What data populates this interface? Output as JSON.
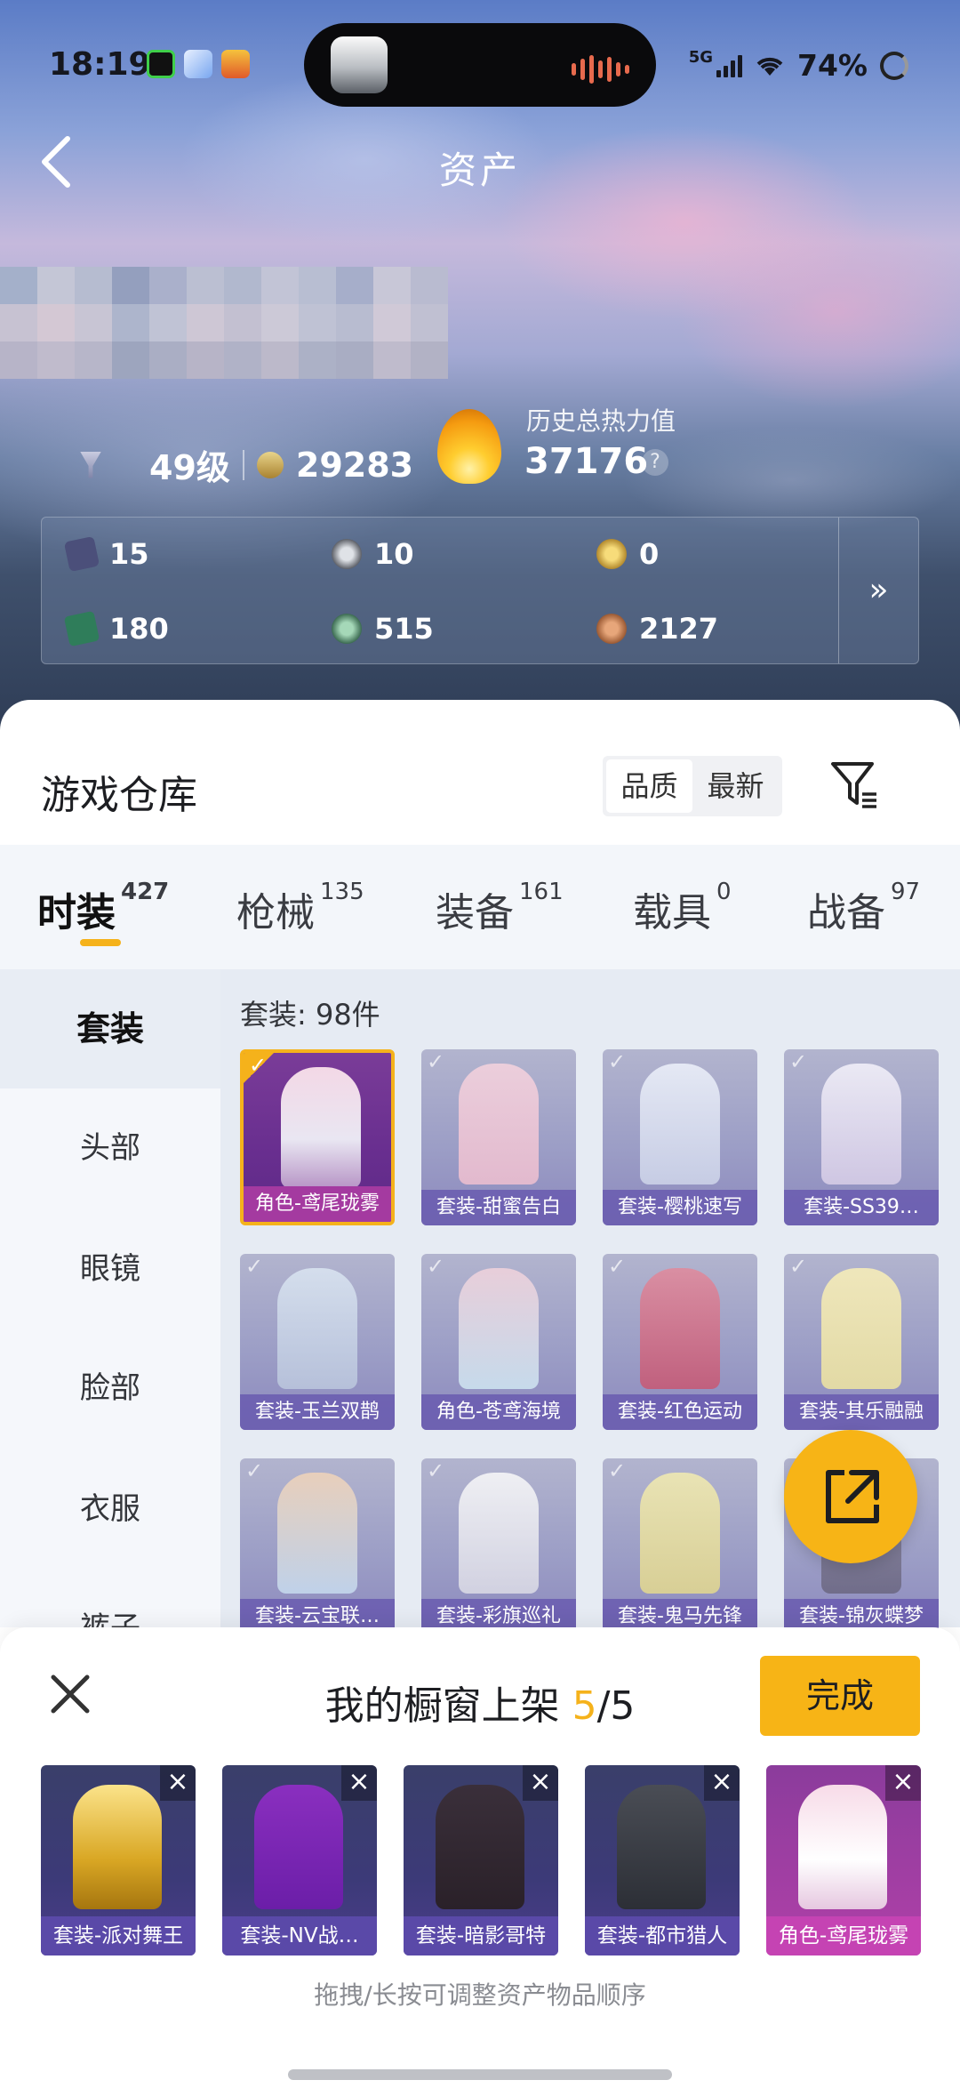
{
  "status_bar": {
    "time": "18:19",
    "network": "5G",
    "battery": "74%"
  },
  "header": {
    "title": "资产",
    "back_icon": "chevron-left-icon"
  },
  "profile": {
    "level": "49级",
    "points": "29283",
    "heat_label": "历史总热力值",
    "heat_value": "37176",
    "help": "?"
  },
  "resources": [
    {
      "icon": "card-icon",
      "value": "15",
      "color": "#4b4f7a"
    },
    {
      "icon": "coin-silver-icon",
      "value": "10",
      "color": "#5e6169"
    },
    {
      "icon": "coin-gold-icon",
      "value": "0",
      "color": "#b38a2e"
    },
    {
      "icon": "ticket-green-icon",
      "value": "180",
      "color": "#2f7d5a"
    },
    {
      "icon": "gem-green-icon",
      "value": "515",
      "color": "#3c6b52"
    },
    {
      "icon": "coin-bronze-icon",
      "value": "2127",
      "color": "#9b5a34"
    }
  ],
  "resources_more": "»",
  "warehouse": {
    "title": "游戏仓库",
    "sort_options": [
      "品质",
      "最新"
    ],
    "sort_selected": 0
  },
  "tabs": [
    {
      "label": "时装",
      "count": "427"
    },
    {
      "label": "枪械",
      "count": "135"
    },
    {
      "label": "装备",
      "count": "161"
    },
    {
      "label": "载具",
      "count": "0"
    },
    {
      "label": "战备",
      "count": "97"
    }
  ],
  "categories": [
    "套装",
    "头部",
    "眼镜",
    "脸部",
    "衣服",
    "裤子"
  ],
  "item_count": "套装: 98件",
  "items": [
    "角色-鸢尾珑雾",
    "套装-甜蜜告白",
    "套装-樱桃速写",
    "套装-SS39…",
    "套装-玉兰双鹊",
    "角色-苍鸢海境",
    "套装-红色运动",
    "套装-其乐融融",
    "套装-云宝联…",
    "套装-彩旗巡礼",
    "套装-鬼马先锋",
    "套装-锦灰蝶梦"
  ],
  "shelf": {
    "title_prefix": "我的橱窗上架",
    "current": "5",
    "separator": "/",
    "total": "5",
    "done": "完成",
    "items": [
      "套装-派对舞王",
      "套装-NV战…",
      "套装-暗影哥特",
      "套装-都市猎人",
      "角色-鸢尾珑雾"
    ],
    "hint": "拖拽/长按可调整资产物品顺序"
  },
  "colors": {
    "accent": "#f5b21b",
    "accent_btn": "#f7b416"
  }
}
